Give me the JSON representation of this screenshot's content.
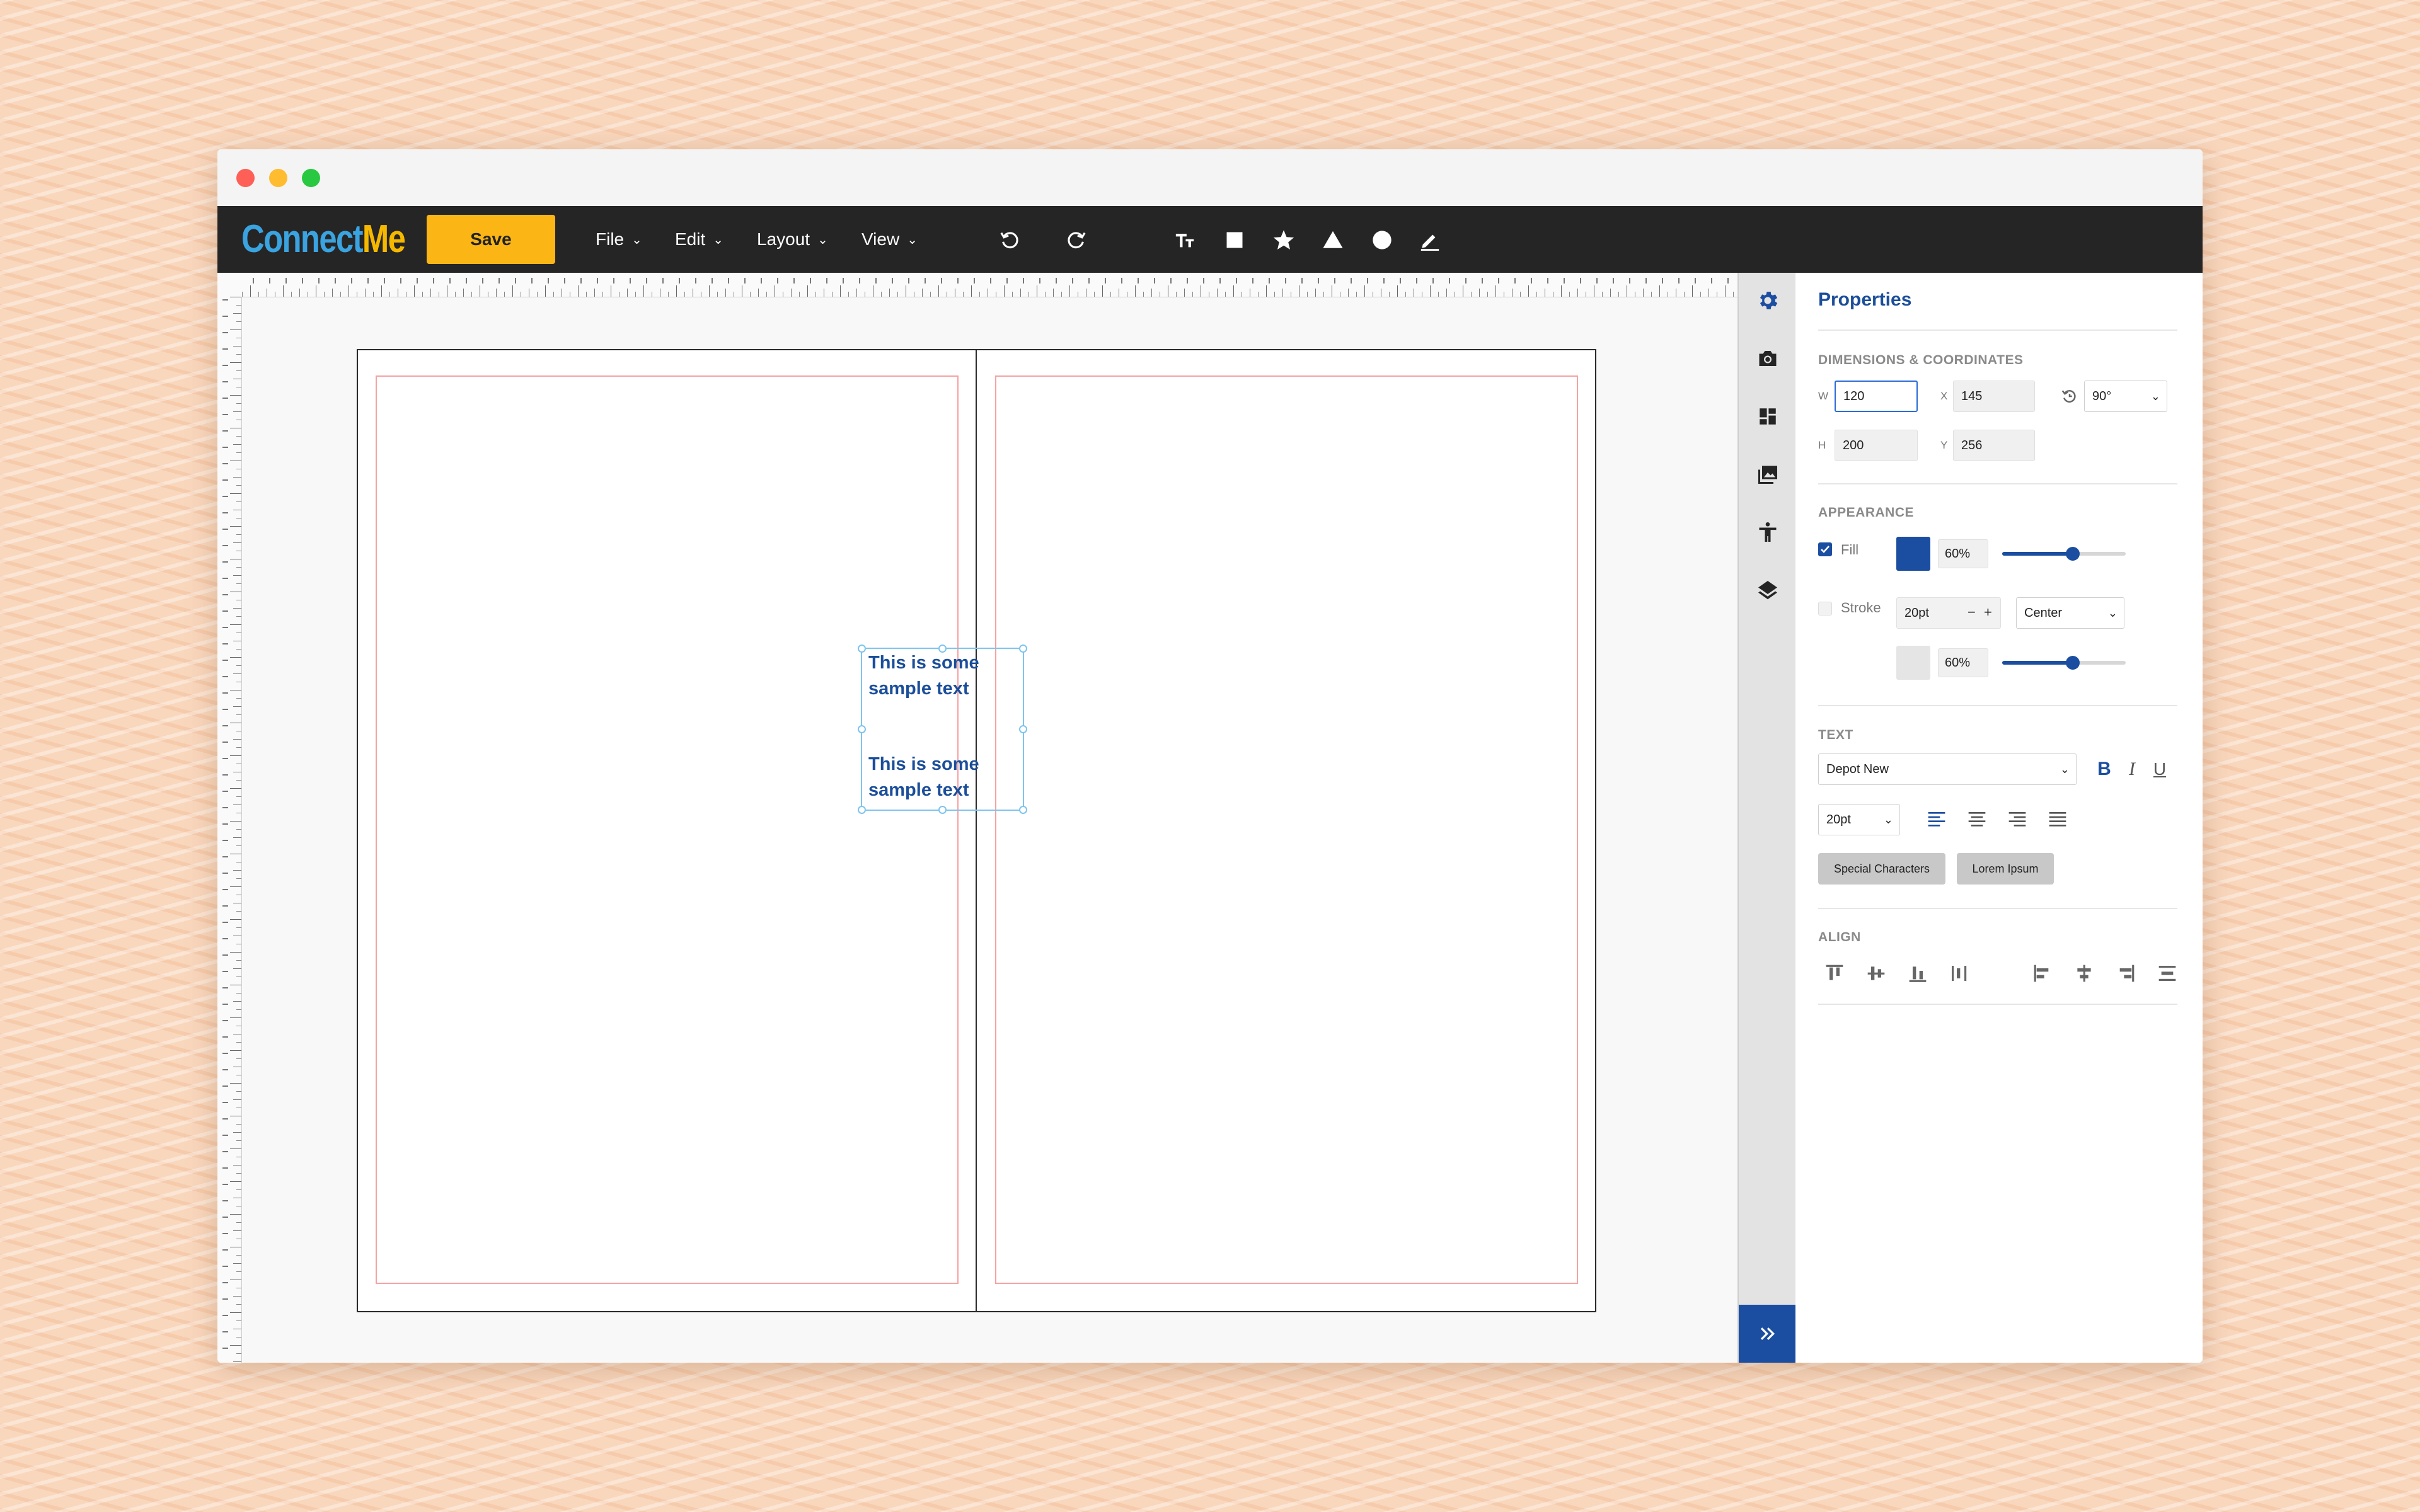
{
  "app": {
    "logo_part1": "Connect",
    "logo_part2": "Me"
  },
  "toolbar": {
    "save_label": "Save",
    "menus": [
      {
        "label": "File"
      },
      {
        "label": "Edit"
      },
      {
        "label": "Layout"
      },
      {
        "label": "View"
      }
    ],
    "history_icons": [
      "undo-icon",
      "redo-icon"
    ],
    "tool_icons": [
      "text-tool-icon",
      "rectangle-tool-icon",
      "star-tool-icon",
      "triangle-tool-icon",
      "circle-tool-icon",
      "pen-tool-icon"
    ]
  },
  "canvas": {
    "text_block_1": "This is some sample text",
    "text_block_2": "This is some sample text"
  },
  "rail": {
    "icons": [
      "gear-icon",
      "camera-icon",
      "dashboard-icon",
      "image-icon",
      "accessibility-icon",
      "layers-icon"
    ],
    "expand_icon": "double-chevron-right-icon"
  },
  "properties": {
    "title": "Properties",
    "dimensions": {
      "section_label": "DIMENSIONS & COORDINATES",
      "w_label": "W",
      "w_value": "120",
      "h_label": "H",
      "h_value": "200",
      "x_label": "X",
      "x_value": "145",
      "y_label": "Y",
      "y_value": "256",
      "rotation_value": "90°"
    },
    "appearance": {
      "section_label": "APPEARANCE",
      "fill_label": "Fill",
      "fill_checked": true,
      "fill_color": "#1b4ea0",
      "fill_opacity": "60%",
      "fill_slider_level": 0.57,
      "stroke_label": "Stroke",
      "stroke_checked": false,
      "stroke_width": "20pt",
      "stroke_minus": "−",
      "stroke_plus": "+",
      "stroke_align": "Center",
      "stroke_color": "#e5e5e5",
      "stroke_opacity": "60%",
      "stroke_slider_level": 0.57
    },
    "text": {
      "section_label": "TEXT",
      "font_family": "Depot New",
      "bold": "B",
      "italic": "I",
      "underline": "U",
      "font_size": "20pt",
      "special_chars_label": "Special Characters",
      "lorem_label": "Lorem Ipsum"
    },
    "align": {
      "section_label": "ALIGN"
    }
  },
  "colors": {
    "accent": "#1b4ea0",
    "save": "#fbb515",
    "toolbar": "#252525",
    "margin_guide": "#f6a2a2",
    "selection": "#7ec4ee"
  }
}
